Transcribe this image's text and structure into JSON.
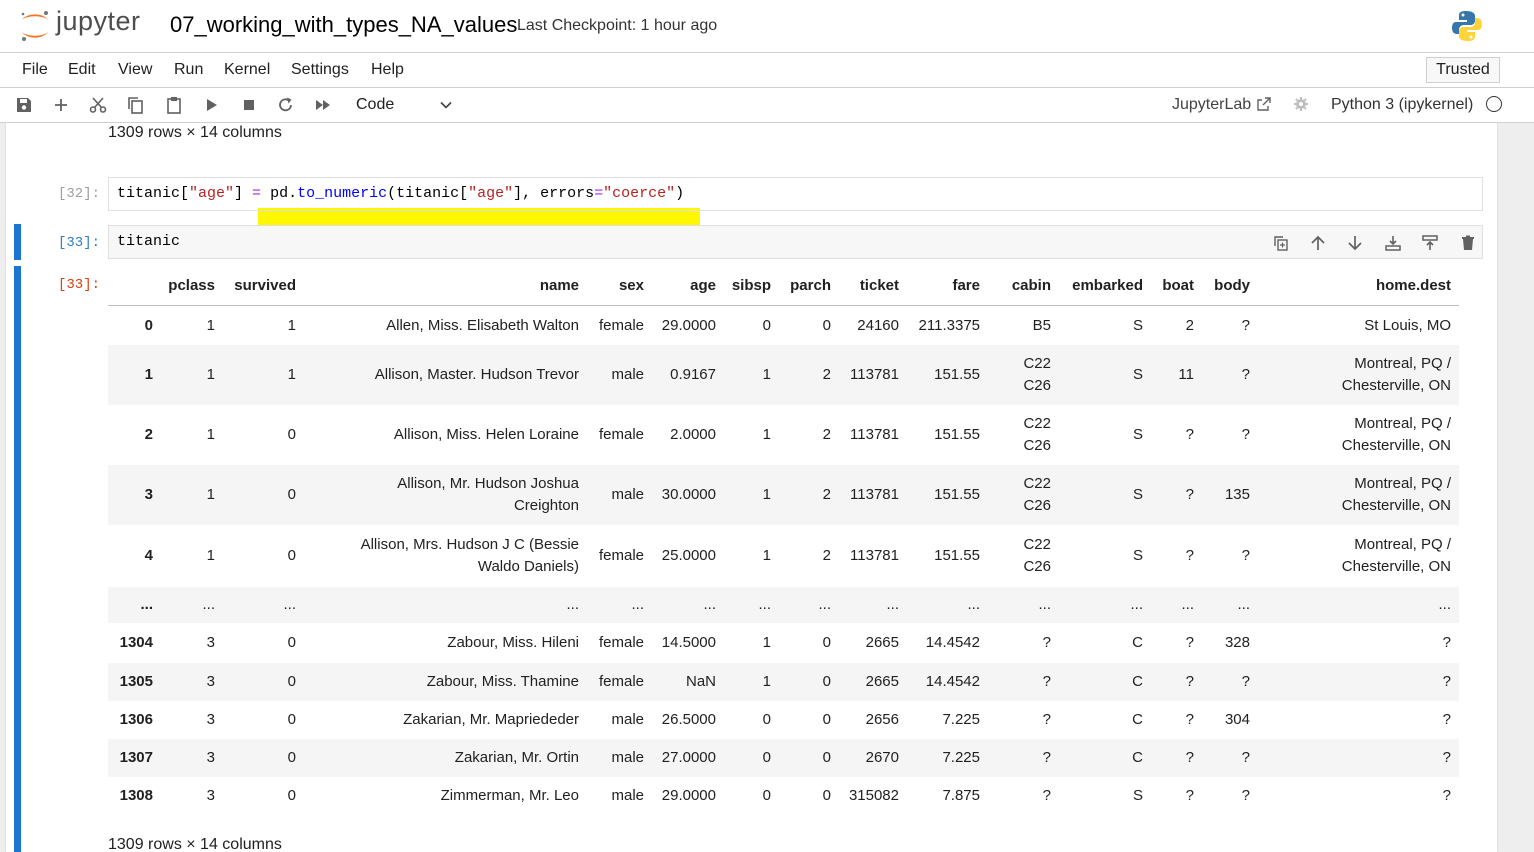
{
  "header": {
    "logo_text": "jupyter",
    "notebook_title": "07_working_with_types_NA_values",
    "checkpoint": "Last Checkpoint: 1 hour ago"
  },
  "menu": {
    "items": [
      "File",
      "Edit",
      "View",
      "Run",
      "Kernel",
      "Settings",
      "Help"
    ],
    "trusted": "Trusted"
  },
  "toolbar": {
    "cell_type": "Code",
    "jupyterlab_link": "JupyterLab",
    "kernel_name": "Python 3 (ipykernel)"
  },
  "notebook": {
    "top_rows_info": "1309 rows × 14 columns",
    "cell32": {
      "prompt": "[32]:",
      "tokens": {
        "t1": "titanic[",
        "s1": "\"age\"",
        "t2": "] ",
        "op": "=",
        "t3": " pd.",
        "fn": "to_numeric",
        "t4": "(titanic[",
        "s2": "\"age\"",
        "t5": "], errors",
        "op2": "=",
        "s3": "\"coerce\"",
        "t6": ")"
      }
    },
    "cell33": {
      "prompt": "[33]:",
      "code": "titanic"
    },
    "out33_prompt": "[33]:",
    "bottom_rows_info": "1309 rows × 14 columns"
  },
  "table": {
    "columns": [
      "",
      "pclass",
      "survived",
      "name",
      "sex",
      "age",
      "sibsp",
      "parch",
      "ticket",
      "fare",
      "cabin",
      "embarked",
      "boat",
      "body",
      "home.dest"
    ],
    "rows": [
      [
        "0",
        "1",
        "1",
        "Allen, Miss. Elisabeth Walton",
        "female",
        "29.0000",
        "0",
        "0",
        "24160",
        "211.3375",
        "B5",
        "S",
        "2",
        "?",
        "St Louis, MO"
      ],
      [
        "1",
        "1",
        "1",
        "Allison, Master. Hudson Trevor",
        "male",
        "0.9167",
        "1",
        "2",
        "113781",
        "151.55",
        "C22\nC26",
        "S",
        "11",
        "?",
        "Montreal, PQ /\nChesterville, ON"
      ],
      [
        "2",
        "1",
        "0",
        "Allison, Miss. Helen Loraine",
        "female",
        "2.0000",
        "1",
        "2",
        "113781",
        "151.55",
        "C22\nC26",
        "S",
        "?",
        "?",
        "Montreal, PQ /\nChesterville, ON"
      ],
      [
        "3",
        "1",
        "0",
        "Allison, Mr. Hudson Joshua\nCreighton",
        "male",
        "30.0000",
        "1",
        "2",
        "113781",
        "151.55",
        "C22\nC26",
        "S",
        "?",
        "135",
        "Montreal, PQ /\nChesterville, ON"
      ],
      [
        "4",
        "1",
        "0",
        "Allison, Mrs. Hudson J C (Bessie\nWaldo Daniels)",
        "female",
        "25.0000",
        "1",
        "2",
        "113781",
        "151.55",
        "C22\nC26",
        "S",
        "?",
        "?",
        "Montreal, PQ /\nChesterville, ON"
      ],
      [
        "...",
        "...",
        "...",
        "...",
        "...",
        "...",
        "...",
        "...",
        "...",
        "...",
        "...",
        "...",
        "...",
        "...",
        "..."
      ],
      [
        "1304",
        "3",
        "0",
        "Zabour, Miss. Hileni",
        "female",
        "14.5000",
        "1",
        "0",
        "2665",
        "14.4542",
        "?",
        "C",
        "?",
        "328",
        "?"
      ],
      [
        "1305",
        "3",
        "0",
        "Zabour, Miss. Thamine",
        "female",
        "NaN",
        "1",
        "0",
        "2665",
        "14.4542",
        "?",
        "C",
        "?",
        "?",
        "?"
      ],
      [
        "1306",
        "3",
        "0",
        "Zakarian, Mr. Mapriededer",
        "male",
        "26.5000",
        "0",
        "0",
        "2656",
        "7.225",
        "?",
        "C",
        "?",
        "304",
        "?"
      ],
      [
        "1307",
        "3",
        "0",
        "Zakarian, Mr. Ortin",
        "male",
        "27.0000",
        "0",
        "0",
        "2670",
        "7.225",
        "?",
        "C",
        "?",
        "?",
        "?"
      ],
      [
        "1308",
        "3",
        "0",
        "Zimmerman, Mr. Leo",
        "male",
        "29.0000",
        "0",
        "0",
        "315082",
        "7.875",
        "?",
        "S",
        "?",
        "?",
        "?"
      ]
    ]
  },
  "colors": {
    "accent": "#1976d2",
    "highlight": "#fff700",
    "output_prompt": "#d84315"
  }
}
